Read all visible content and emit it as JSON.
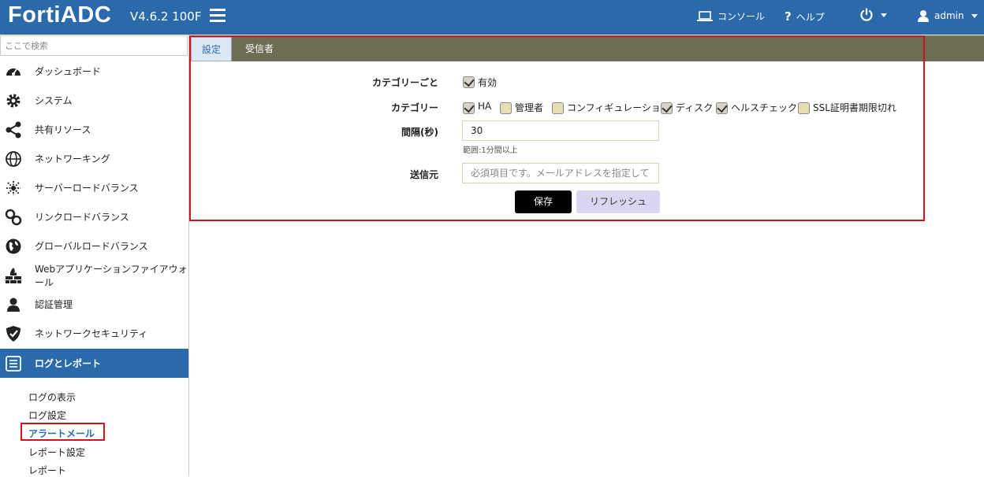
{
  "header": {
    "logo": "FortiADC",
    "version": "V4.6.2 100F",
    "console_label": "コンソール",
    "help_label": "ヘルプ",
    "user_label": "admin"
  },
  "sidebar": {
    "search_placeholder": "ここで検索",
    "items": [
      {
        "label": "ダッシュボード",
        "icon": "dashboard-icon"
      },
      {
        "label": "システム",
        "icon": "gear-icon"
      },
      {
        "label": "共有リソース",
        "icon": "share-icon"
      },
      {
        "label": "ネットワーキング",
        "icon": "globe-icon"
      },
      {
        "label": "サーバーロードバランス",
        "icon": "server-lb-icon"
      },
      {
        "label": "リンクロードバランス",
        "icon": "link-icon"
      },
      {
        "label": "グローバルロードバランス",
        "icon": "world-icon"
      },
      {
        "label": "Webアプリケーションファイアウォール",
        "icon": "firewall-icon"
      },
      {
        "label": "認証管理",
        "icon": "user-icon"
      },
      {
        "label": "ネットワークセキュリティ",
        "icon": "shield-icon"
      },
      {
        "label": "ログとレポート",
        "icon": "list-icon"
      }
    ],
    "sub_items": [
      "ログの表示",
      "ログ設定",
      "アラートメール",
      "レポート設定",
      "レポート"
    ]
  },
  "tabs": {
    "settings": "設定",
    "recipients": "受信者"
  },
  "form": {
    "by_category_label": "カテゴリーごと",
    "enabled_label": "有効",
    "enabled_checked": true,
    "category_label": "カテゴリー",
    "categories": [
      {
        "label": "HA",
        "checked": true
      },
      {
        "label": "管理者",
        "checked": false
      },
      {
        "label": "コンフィギュレーション",
        "checked": false
      },
      {
        "label": "ディスク",
        "checked": true
      },
      {
        "label": "ヘルスチェック",
        "checked": true
      },
      {
        "label": "SSL証明書期限切れ",
        "checked": false
      }
    ],
    "interval_label": "間隔(秒)",
    "interval_value": "30",
    "interval_hint": "範囲:1分間以上",
    "sender_label": "送信元",
    "sender_placeholder": "必須項目です。メールアドレスを指定してください",
    "save_label": "保存",
    "refresh_label": "リフレッシュ"
  },
  "colors": {
    "topbar": "#2a6aab",
    "tabbar": "#6e6c53",
    "highlight": "#d0141c"
  }
}
